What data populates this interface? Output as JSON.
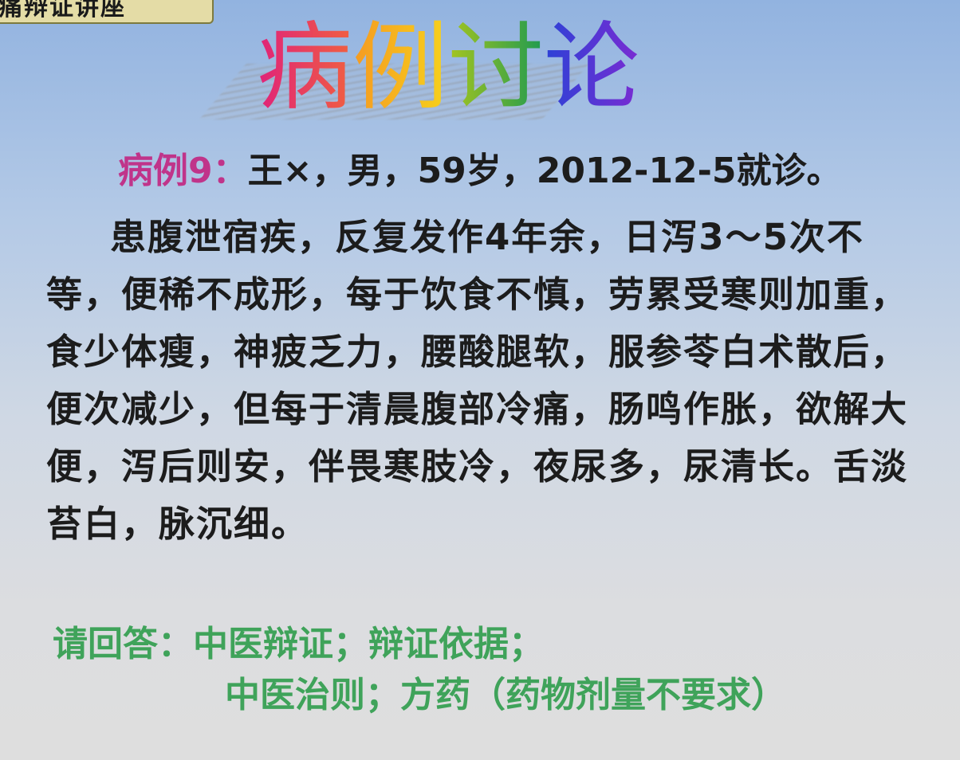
{
  "header_tab": {
    "label": "痛辩证讲座"
  },
  "title": {
    "chars": [
      "病",
      "例",
      "讨",
      "论"
    ]
  },
  "case": {
    "label": "病例9：",
    "info": "王×，男，59岁，2012-12-5就诊。"
  },
  "description": "患腹泄宿疾，反复发作4年余，日泻3～5次不等，便稀不成形，每于饮食不慎，劳累受寒则加重，食少体瘦，神疲乏力，腰酸腿软，服参苓白术散后，便次减少，但每于清晨腹部冷痛，肠鸣作胀，欲解大便，泻后则安，伴畏寒肢冷，夜尿多，尿清长。舌淡苔白，脉沉细。",
  "question": {
    "label": "请回答：",
    "line1": "中医辩证；辩证依据；",
    "line2": "中医治则；方药（药物剂量不要求）"
  },
  "colors": {
    "case_label": "#c0348a",
    "question": "#3fa35a",
    "text": "#1c1c1c",
    "tab_bg": "#e4dca6"
  }
}
